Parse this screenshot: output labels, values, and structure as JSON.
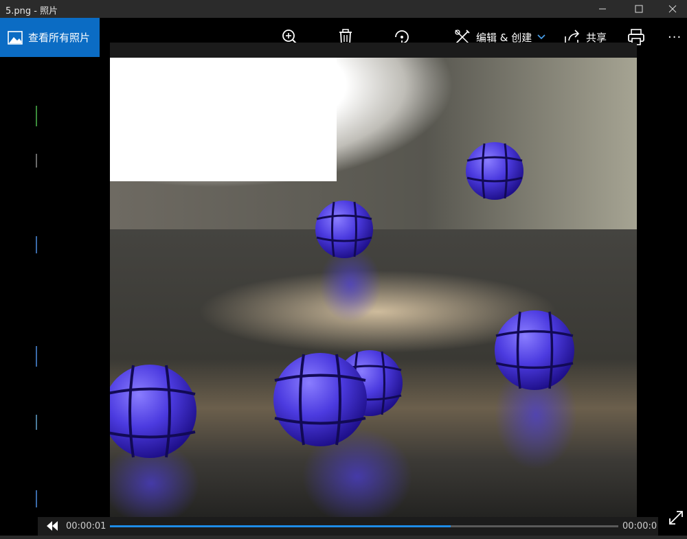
{
  "window": {
    "title": "5.png - 照片"
  },
  "nav": {
    "all_photos_label": "查看所有照片"
  },
  "toolbar": {
    "zoom_icon": "zoom-in-icon",
    "delete_icon": "trash-icon",
    "rotate_icon": "rotate-icon",
    "edit_label": "编辑 & 创建",
    "share_label": "共享",
    "print_icon": "printer-icon",
    "more_label": "···"
  },
  "player": {
    "current_time": "00:00:01",
    "end_time": "00:00:0",
    "progress_fraction": 0.67
  },
  "colors": {
    "accent": "#0b6cc4",
    "progress": "#1e8ce8",
    "titlebar": "#2b2b2b"
  }
}
